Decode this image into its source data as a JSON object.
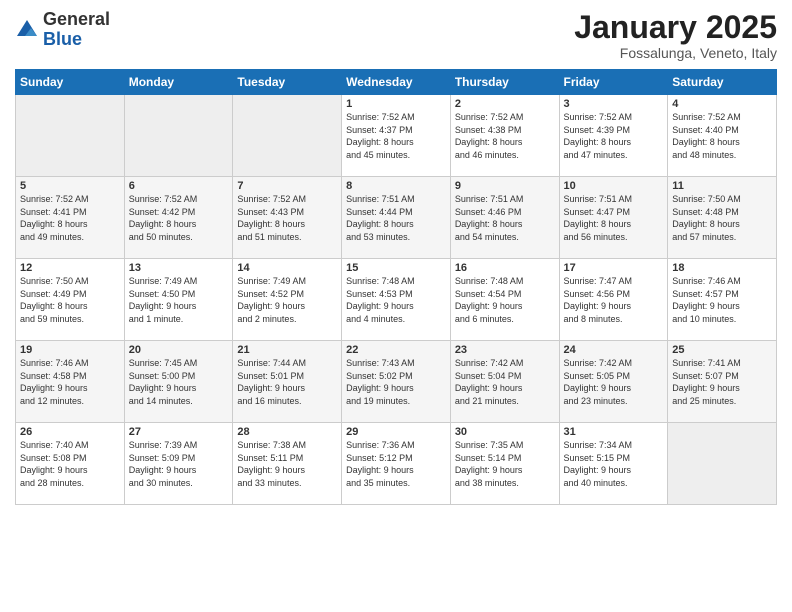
{
  "logo": {
    "general": "General",
    "blue": "Blue"
  },
  "title": "January 2025",
  "subtitle": "Fossalunga, Veneto, Italy",
  "headers": [
    "Sunday",
    "Monday",
    "Tuesday",
    "Wednesday",
    "Thursday",
    "Friday",
    "Saturday"
  ],
  "weeks": [
    [
      {
        "day": "",
        "content": ""
      },
      {
        "day": "",
        "content": ""
      },
      {
        "day": "",
        "content": ""
      },
      {
        "day": "1",
        "content": "Sunrise: 7:52 AM\nSunset: 4:37 PM\nDaylight: 8 hours\nand 45 minutes."
      },
      {
        "day": "2",
        "content": "Sunrise: 7:52 AM\nSunset: 4:38 PM\nDaylight: 8 hours\nand 46 minutes."
      },
      {
        "day": "3",
        "content": "Sunrise: 7:52 AM\nSunset: 4:39 PM\nDaylight: 8 hours\nand 47 minutes."
      },
      {
        "day": "4",
        "content": "Sunrise: 7:52 AM\nSunset: 4:40 PM\nDaylight: 8 hours\nand 48 minutes."
      }
    ],
    [
      {
        "day": "5",
        "content": "Sunrise: 7:52 AM\nSunset: 4:41 PM\nDaylight: 8 hours\nand 49 minutes."
      },
      {
        "day": "6",
        "content": "Sunrise: 7:52 AM\nSunset: 4:42 PM\nDaylight: 8 hours\nand 50 minutes."
      },
      {
        "day": "7",
        "content": "Sunrise: 7:52 AM\nSunset: 4:43 PM\nDaylight: 8 hours\nand 51 minutes."
      },
      {
        "day": "8",
        "content": "Sunrise: 7:51 AM\nSunset: 4:44 PM\nDaylight: 8 hours\nand 53 minutes."
      },
      {
        "day": "9",
        "content": "Sunrise: 7:51 AM\nSunset: 4:46 PM\nDaylight: 8 hours\nand 54 minutes."
      },
      {
        "day": "10",
        "content": "Sunrise: 7:51 AM\nSunset: 4:47 PM\nDaylight: 8 hours\nand 56 minutes."
      },
      {
        "day": "11",
        "content": "Sunrise: 7:50 AM\nSunset: 4:48 PM\nDaylight: 8 hours\nand 57 minutes."
      }
    ],
    [
      {
        "day": "12",
        "content": "Sunrise: 7:50 AM\nSunset: 4:49 PM\nDaylight: 8 hours\nand 59 minutes."
      },
      {
        "day": "13",
        "content": "Sunrise: 7:49 AM\nSunset: 4:50 PM\nDaylight: 9 hours\nand 1 minute."
      },
      {
        "day": "14",
        "content": "Sunrise: 7:49 AM\nSunset: 4:52 PM\nDaylight: 9 hours\nand 2 minutes."
      },
      {
        "day": "15",
        "content": "Sunrise: 7:48 AM\nSunset: 4:53 PM\nDaylight: 9 hours\nand 4 minutes."
      },
      {
        "day": "16",
        "content": "Sunrise: 7:48 AM\nSunset: 4:54 PM\nDaylight: 9 hours\nand 6 minutes."
      },
      {
        "day": "17",
        "content": "Sunrise: 7:47 AM\nSunset: 4:56 PM\nDaylight: 9 hours\nand 8 minutes."
      },
      {
        "day": "18",
        "content": "Sunrise: 7:46 AM\nSunset: 4:57 PM\nDaylight: 9 hours\nand 10 minutes."
      }
    ],
    [
      {
        "day": "19",
        "content": "Sunrise: 7:46 AM\nSunset: 4:58 PM\nDaylight: 9 hours\nand 12 minutes."
      },
      {
        "day": "20",
        "content": "Sunrise: 7:45 AM\nSunset: 5:00 PM\nDaylight: 9 hours\nand 14 minutes."
      },
      {
        "day": "21",
        "content": "Sunrise: 7:44 AM\nSunset: 5:01 PM\nDaylight: 9 hours\nand 16 minutes."
      },
      {
        "day": "22",
        "content": "Sunrise: 7:43 AM\nSunset: 5:02 PM\nDaylight: 9 hours\nand 19 minutes."
      },
      {
        "day": "23",
        "content": "Sunrise: 7:42 AM\nSunset: 5:04 PM\nDaylight: 9 hours\nand 21 minutes."
      },
      {
        "day": "24",
        "content": "Sunrise: 7:42 AM\nSunset: 5:05 PM\nDaylight: 9 hours\nand 23 minutes."
      },
      {
        "day": "25",
        "content": "Sunrise: 7:41 AM\nSunset: 5:07 PM\nDaylight: 9 hours\nand 25 minutes."
      }
    ],
    [
      {
        "day": "26",
        "content": "Sunrise: 7:40 AM\nSunset: 5:08 PM\nDaylight: 9 hours\nand 28 minutes."
      },
      {
        "day": "27",
        "content": "Sunrise: 7:39 AM\nSunset: 5:09 PM\nDaylight: 9 hours\nand 30 minutes."
      },
      {
        "day": "28",
        "content": "Sunrise: 7:38 AM\nSunset: 5:11 PM\nDaylight: 9 hours\nand 33 minutes."
      },
      {
        "day": "29",
        "content": "Sunrise: 7:36 AM\nSunset: 5:12 PM\nDaylight: 9 hours\nand 35 minutes."
      },
      {
        "day": "30",
        "content": "Sunrise: 7:35 AM\nSunset: 5:14 PM\nDaylight: 9 hours\nand 38 minutes."
      },
      {
        "day": "31",
        "content": "Sunrise: 7:34 AM\nSunset: 5:15 PM\nDaylight: 9 hours\nand 40 minutes."
      },
      {
        "day": "",
        "content": ""
      }
    ]
  ]
}
